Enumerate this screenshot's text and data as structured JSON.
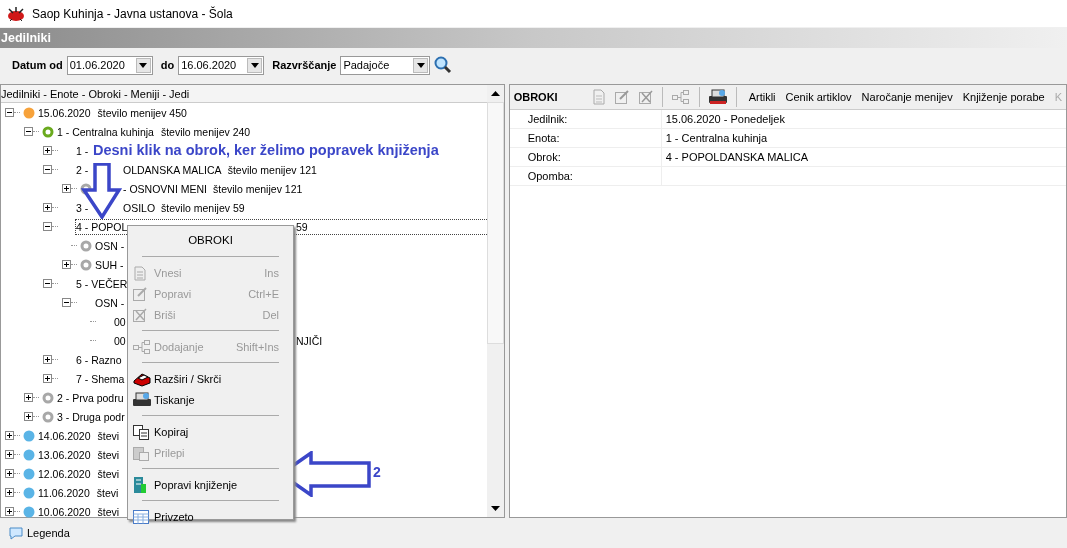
{
  "window": {
    "title": "Saop Kuhinja  - Javna ustanova - Šola"
  },
  "section": {
    "title": "Jedilniki"
  },
  "filter": {
    "from_label": "Datum od",
    "from_value": "01.06.2020",
    "to_label": "do",
    "to_value": "16.06.2020",
    "sort_label": "Razvrščanje",
    "sort_value": "Padajoče"
  },
  "tree": {
    "header": "Jedilniki - Enote - Obroki - Meniji - Jedi",
    "items": [
      {
        "label": "15.06.2020",
        "count": "število menijev 450",
        "expanded": true,
        "selected": false,
        "dot": {
          "kind": "filled",
          "color": "#f7a23a"
        },
        "children": [
          {
            "label": "1 - Centralna kuhinja",
            "count": "število menijev 240",
            "expanded": true,
            "selected": false,
            "dot": {
              "kind": "ring",
              "color": "#6aaa1e"
            },
            "children": [
              {
                "label": "1 -",
                "expanded": false,
                "selected": false
              },
              {
                "label": "2 -",
                "after_arrow": "OLDANSKA MALICA",
                "count": "število menijev 121",
                "expanded": true,
                "selected": false,
                "children": [
                  {
                    "after_arrow": "- OSNOVNI MENI",
                    "count": "število menijev 121",
                    "expanded": false,
                    "selected": false,
                    "dot": {
                      "kind": "ring",
                      "color": "#a8a8a8"
                    }
                  }
                ]
              },
              {
                "label": "3 -",
                "after_arrow": "OSILO",
                "count": "število menijev 59",
                "expanded": false,
                "selected": false
              },
              {
                "label": "4 - POPOL",
                "tail": "59",
                "expanded": true,
                "selected": true,
                "children": [
                  {
                    "label": "OSN -",
                    "selected": false,
                    "dot": {
                      "kind": "ring",
                      "color": "#a8a8a8"
                    }
                  },
                  {
                    "label": "SUH -",
                    "expanded": false,
                    "selected": false,
                    "dot": {
                      "kind": "ring",
                      "color": "#a8a8a8"
                    }
                  }
                ]
              },
              {
                "label": "5 - VEČER",
                "expanded": true,
                "selected": false,
                "children": [
                  {
                    "label": "OSN -",
                    "expanded": true,
                    "selected": false,
                    "children": [
                      {
                        "label": "00",
                        "selected": false
                      },
                      {
                        "label": "00",
                        "tail": "NJIČI",
                        "selected": false
                      }
                    ]
                  }
                ]
              },
              {
                "label": "6 - Razno",
                "expanded": false,
                "selected": false
              },
              {
                "label": "7 - Shema",
                "expanded": false,
                "selected": false
              }
            ]
          },
          {
            "label": "2 - Prva podru",
            "expanded": false,
            "selected": false,
            "dot": {
              "kind": "ring",
              "color": "#a8a8a8"
            }
          },
          {
            "label": "3 - Druga podr",
            "expanded": false,
            "selected": false,
            "dot": {
              "kind": "ring",
              "color": "#a8a8a8"
            }
          }
        ]
      },
      {
        "label": "14.06.2020",
        "count": "števi",
        "expanded": false,
        "selected": false,
        "dot": {
          "kind": "filled",
          "color": "#5ab4e6"
        }
      },
      {
        "label": "13.06.2020",
        "count": "števi",
        "expanded": false,
        "selected": false,
        "dot": {
          "kind": "filled",
          "color": "#5ab4e6"
        }
      },
      {
        "label": "12.06.2020",
        "count": "števi",
        "expanded": false,
        "selected": false,
        "dot": {
          "kind": "filled",
          "color": "#5ab4e6"
        }
      },
      {
        "label": "11.06.2020",
        "count": "števi",
        "expanded": false,
        "selected": false,
        "dot": {
          "kind": "filled",
          "color": "#5ab4e6"
        }
      },
      {
        "label": "10.06.2020",
        "count": "števi",
        "expanded": false,
        "selected": false,
        "dot": {
          "kind": "filled",
          "color": "#5ab4e6"
        }
      }
    ]
  },
  "context_menu": {
    "title": "OBROKI",
    "items": [
      {
        "kind": "separator"
      },
      {
        "kind": "item",
        "label": "Vnesi",
        "shortcut": "Ins",
        "disabled": true
      },
      {
        "kind": "item",
        "label": "Popravi",
        "shortcut": "Ctrl+E",
        "disabled": true
      },
      {
        "kind": "item",
        "label": "Briši",
        "shortcut": "Del",
        "disabled": true
      },
      {
        "kind": "separator"
      },
      {
        "kind": "item",
        "label": "Dodajanje",
        "shortcut": "Shift+Ins",
        "disabled": true
      },
      {
        "kind": "separator"
      },
      {
        "kind": "item",
        "label": "Razširi / Skrči",
        "disabled": false
      },
      {
        "kind": "item",
        "label": "Tiskanje",
        "disabled": false
      },
      {
        "kind": "separator"
      },
      {
        "kind": "item",
        "label": "Kopiraj",
        "disabled": false
      },
      {
        "kind": "item",
        "label": "Prilepi",
        "disabled": true
      },
      {
        "kind": "separator"
      },
      {
        "kind": "item",
        "label": "Popravi knjiženje",
        "disabled": false
      },
      {
        "kind": "separator"
      },
      {
        "kind": "item",
        "label": "Privzeto",
        "disabled": false
      }
    ]
  },
  "annotations": {
    "instruction": "Desni klik na obrok, ker želimo popravek knjiženja",
    "step": "2"
  },
  "details": {
    "title": "OBROKI",
    "toolbar": [
      {
        "label": "Artikli",
        "disabled": false
      },
      {
        "label": "Cenik artiklov",
        "disabled": false
      },
      {
        "label": "Naročanje menijev",
        "disabled": false
      },
      {
        "label": "Knjiženje porabe",
        "disabled": false
      },
      {
        "label": "K",
        "disabled": true
      }
    ],
    "fields": [
      {
        "label": "Jedilnik:",
        "value": "15.06.2020 - Ponedeljek"
      },
      {
        "label": "Enota:",
        "value": "1 - Centralna kuhinja"
      },
      {
        "label": "Obrok:",
        "value": "4 - POPOLDANSKA MALICA"
      },
      {
        "label": "Opomba:"
      }
    ]
  },
  "status_bar": {
    "legend": "Legenda"
  }
}
